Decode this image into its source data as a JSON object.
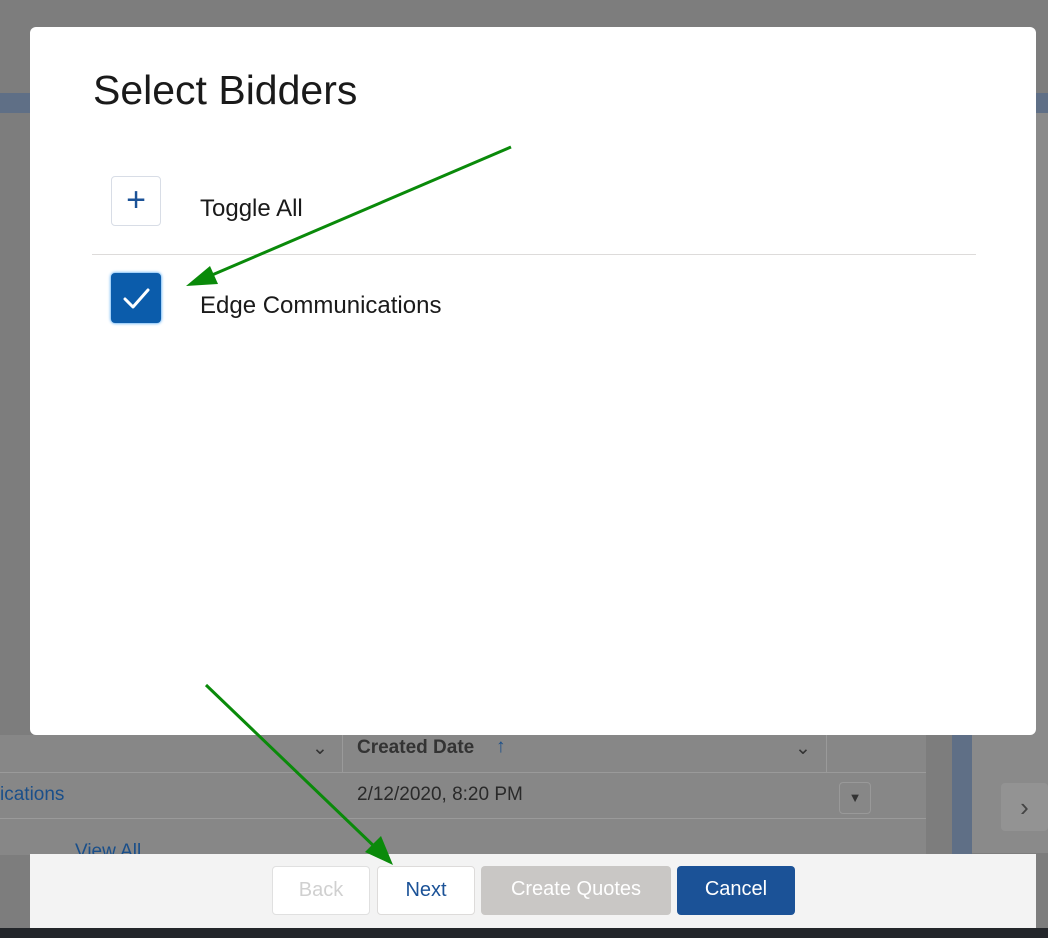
{
  "background": {
    "column_header": "Created Date",
    "sort_icon": "arrow-up-icon",
    "link_text": "ications",
    "date_value": "2/12/2020, 8:20 PM",
    "view_all": "View All"
  },
  "modal": {
    "title": "Select Bidders",
    "toggle_all_label": "Toggle All",
    "items": [
      {
        "label": "Edge Communications",
        "checked": true
      }
    ]
  },
  "footer": {
    "back_label": "Back",
    "next_label": "Next",
    "create_quotes_label": "Create Quotes",
    "cancel_label": "Cancel"
  },
  "colors": {
    "accent": "#1b5297",
    "annotation_arrow": "#0a8a0a"
  }
}
